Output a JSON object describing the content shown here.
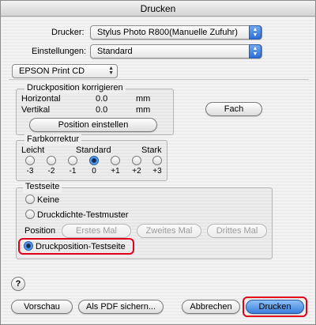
{
  "window": {
    "title": "Drucken"
  },
  "printer": {
    "label": "Drucker:",
    "value": "Stylus Photo R800(Manuelle Zufuhr)"
  },
  "presets": {
    "label": "Einstellungen:",
    "value": "Standard"
  },
  "panel": {
    "value": "EPSON Print CD"
  },
  "print_position": {
    "title": "Druckposition korrigieren",
    "horizontal_label": "Horizontal",
    "horizontal_value": "0.0",
    "horizontal_unit": "mm",
    "vertical_label": "Vertikal",
    "vertical_value": "0.0",
    "vertical_unit": "mm",
    "set_button": "Position einstellen",
    "tray_button": "Fach"
  },
  "color_correction": {
    "title": "Farbkorrektur",
    "low_label": "Leicht",
    "standard_label": "Standard",
    "high_label": "Stark",
    "ticks": [
      "-3",
      "-2",
      "-1",
      "0",
      "+1",
      "+2",
      "+3"
    ],
    "selected_index": 3
  },
  "test_page": {
    "title": "Testseite",
    "option_none": "Keine",
    "option_density": "Druckdichte-Testmuster",
    "position_label": "Position",
    "btn_first": "Erstes Mal",
    "btn_second": "Zweites Mal",
    "btn_third": "Drittes Mal",
    "option_position": "Druckposition-Testseite"
  },
  "help": {
    "symbol": "?"
  },
  "footer": {
    "preview": "Vorschau",
    "save_pdf": "Als PDF sichern...",
    "cancel": "Abbrechen",
    "print": "Drucken"
  },
  "colors": {
    "accent": "#3b7fdc",
    "highlight": "#e0001a"
  }
}
